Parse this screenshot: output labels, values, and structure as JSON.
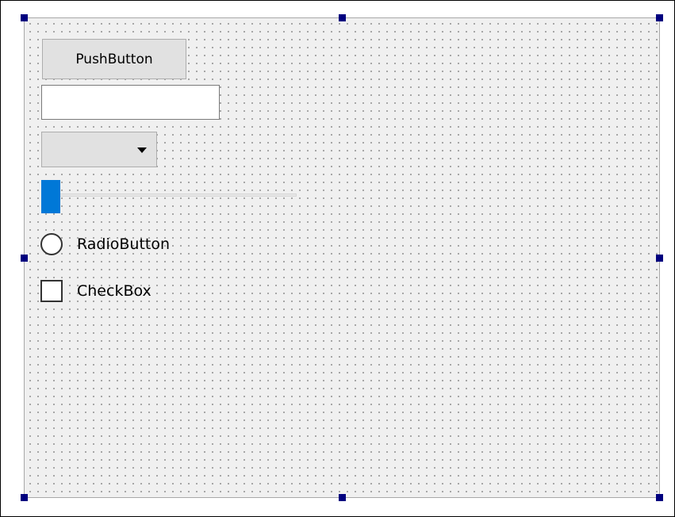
{
  "form": {
    "push_button_label": "PushButton",
    "line_edit_value": "",
    "combo_box_value": "",
    "slider_value_fraction": 0.0,
    "radio_button_label": "RadioButton",
    "radio_button_checked": false,
    "check_box_label": "CheckBox",
    "check_box_checked": false
  },
  "icons": {
    "combo_arrow": "chevron-down-icon",
    "selection_handle": "resize-handle-icon"
  },
  "colors": {
    "form_background": "#f0f0f0",
    "grid_dot": "#9a9a9a",
    "selection_handle": "#00007f",
    "slider_handle": "#0078d7",
    "button_face": "#e1e1e1"
  }
}
